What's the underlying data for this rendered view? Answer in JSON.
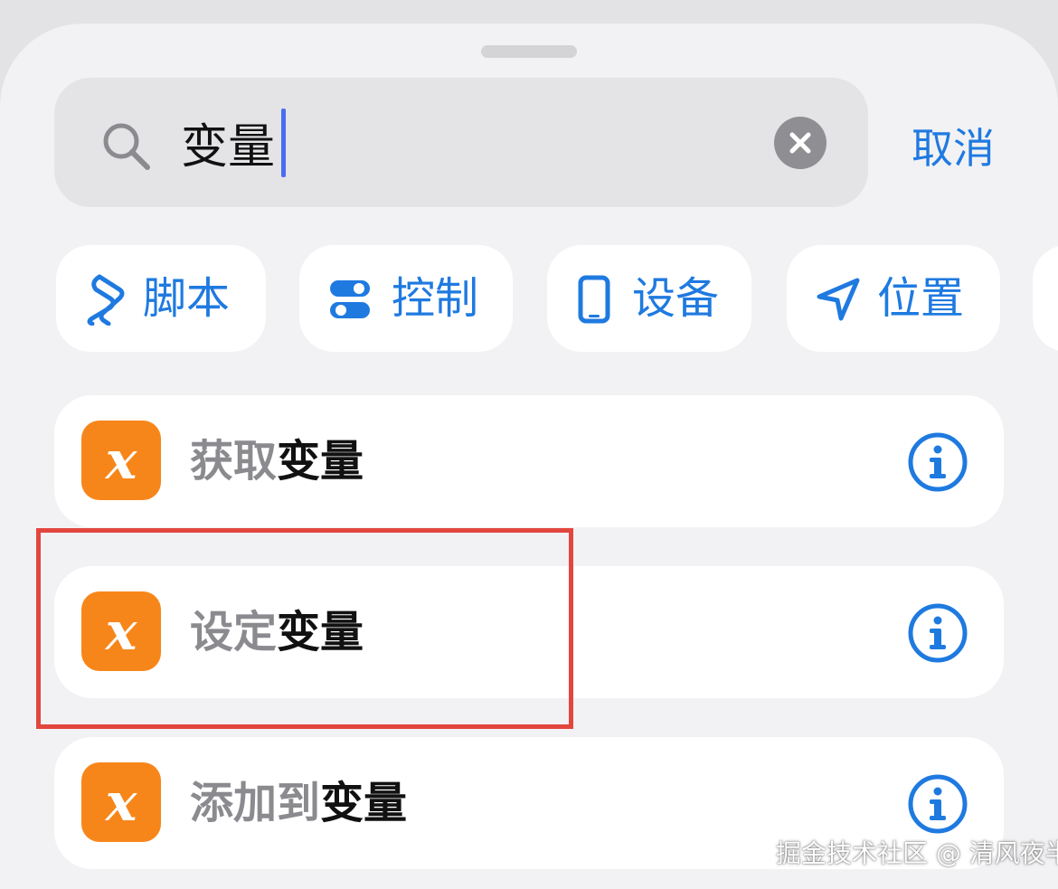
{
  "search": {
    "query": "变量",
    "cancel_label": "取消"
  },
  "categories": [
    {
      "label": "脚本",
      "icon": "script-icon"
    },
    {
      "label": "控制",
      "icon": "toggle-icon"
    },
    {
      "label": "设备",
      "icon": "phone-icon"
    },
    {
      "label": "位置",
      "icon": "location-arrow-icon"
    }
  ],
  "actions": [
    {
      "prefix": "获取",
      "match": "变量",
      "icon_letter": "x"
    },
    {
      "prefix": "设定",
      "match": "变量",
      "icon_letter": "x"
    },
    {
      "prefix": "添加到",
      "match": "变量",
      "icon_letter": "x"
    }
  ],
  "watermark": "掘金技术社区 @ 清风夜半",
  "colors": {
    "accent": "#1f7ae0",
    "variable_icon": "#f7861a",
    "highlight_box": "#e2463e",
    "caret": "#4a6df0"
  }
}
